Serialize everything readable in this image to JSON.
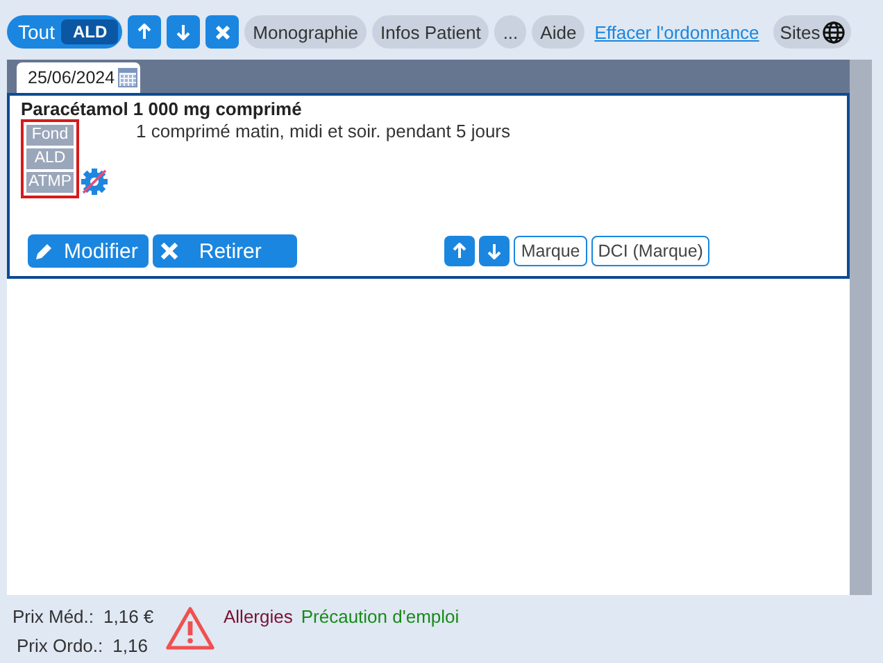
{
  "toolbar": {
    "filter": [
      {
        "label": "Tout",
        "selected": false
      },
      {
        "label": "ALD",
        "selected": true
      }
    ],
    "buttons": [
      "Monographie",
      "Infos Patient",
      "...",
      "Aide"
    ],
    "link": "Effacer l'ordonnance",
    "sites": "Sites"
  },
  "date": "25/06/2024",
  "prescription": {
    "name": "Paracétamol 1 000 mg comprimé",
    "tags": [
      "Fond",
      "ALD",
      "ATMP"
    ],
    "dosage": "1 comprimé matin, midi et soir.  pendant 5 jours",
    "actions": [
      "Modifier",
      "Retirer"
    ],
    "name_buttons": [
      "Marque",
      "DCI (Marque)"
    ]
  },
  "footer": {
    "prix_med_label": "Prix Méd.:",
    "prix_med": "1,16 €",
    "prix_ordo_label": "Prix Ordo.:",
    "prix_ordo": "1,16",
    "allergies": "Allergies",
    "precaution": "Précaution d'emploi"
  }
}
